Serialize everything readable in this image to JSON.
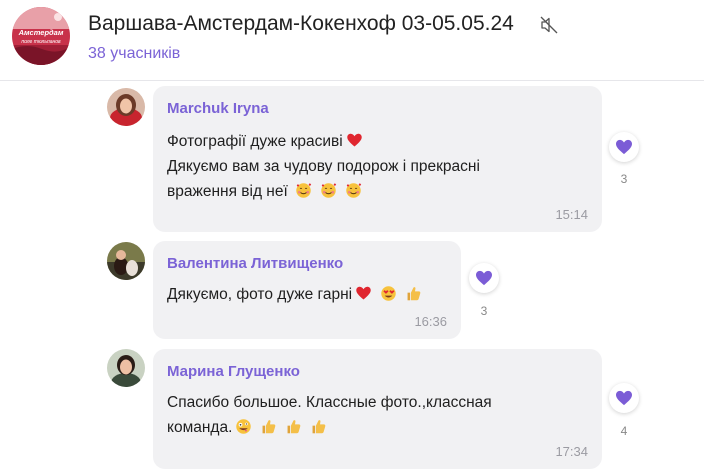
{
  "header": {
    "title": "Варшава-Амстердам-Кокенхоф 03-05.05.24",
    "participants": "38 учасників",
    "avatar_text_1": "Амстердам",
    "avatar_text_2": "поле тюльпанов",
    "mute_icon": "muted-speaker-icon"
  },
  "messages": [
    {
      "author": "Marchuk Iryna",
      "lines": [
        "Фотографії дуже красиві",
        "Дякуємо вам за чудову подорож і прекрасні",
        "враження від неї"
      ],
      "time": "15:14",
      "reaction_count": "3",
      "emoji": [
        "red-heart",
        "smiling-face-with-hearts"
      ]
    },
    {
      "author": "Валентина Литвищенко",
      "lines": [
        "Дякуємо, фото дуже гарні"
      ],
      "time": "16:36",
      "reaction_count": "3",
      "emoji": [
        "red-heart",
        "heart-eyes",
        "thumbs-up"
      ]
    },
    {
      "author": "Марина Глущенко",
      "lines": [
        "Спасибо большое. Классные фото.,классная",
        "команда."
      ],
      "time": "17:34",
      "reaction_count": "4",
      "emoji": [
        "zany-face",
        "thumbs-up"
      ]
    }
  ],
  "colors": {
    "accent": "#7b63d6",
    "heart": "#7b5cd6",
    "bubble": "#f1f1f3"
  }
}
